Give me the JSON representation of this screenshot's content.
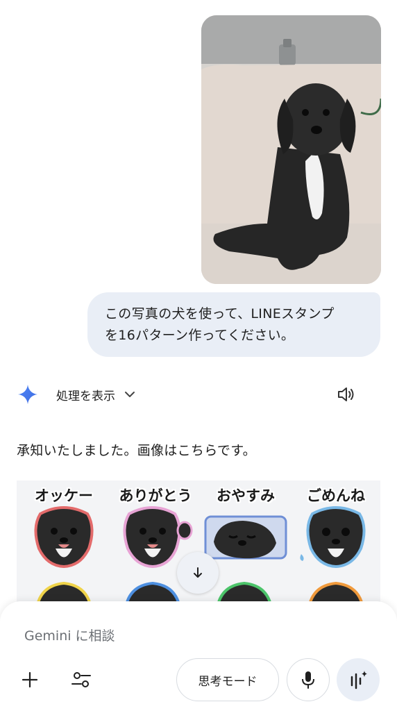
{
  "user_message": {
    "line1": "この写真の犬を使って、LINEスタンプ",
    "line2": "を16パターン作ってください。"
  },
  "reply": {
    "show_process_label": "処理を表示",
    "text": "承知いたしました。画像はこちらです。"
  },
  "stickers": [
    {
      "caption": "オッケー",
      "outline": "#e36b6b"
    },
    {
      "caption": "ありがとう",
      "outline": "#e7a3d4"
    },
    {
      "caption": "おやすみ",
      "outline": "#6f8fd6"
    },
    {
      "caption": "ごめんね",
      "outline": "#79b8e6"
    },
    {
      "caption": "",
      "outline": "#efd34a"
    },
    {
      "caption": "",
      "outline": "#4d8fe0"
    },
    {
      "caption": "",
      "outline": "#4cc46a"
    },
    {
      "caption": "",
      "outline": "#f09a3c"
    }
  ],
  "composer": {
    "placeholder": "Gemini に相談",
    "mode_label": "思考モード"
  },
  "icons": {
    "gemini": "gemini-sparkle-icon",
    "chevron": "chevron-down-icon",
    "speaker": "speaker-icon",
    "scroll": "arrow-down-icon",
    "plus": "plus-icon",
    "tools": "tools-icon",
    "mic": "microphone-icon",
    "live": "gemini-live-icon"
  }
}
